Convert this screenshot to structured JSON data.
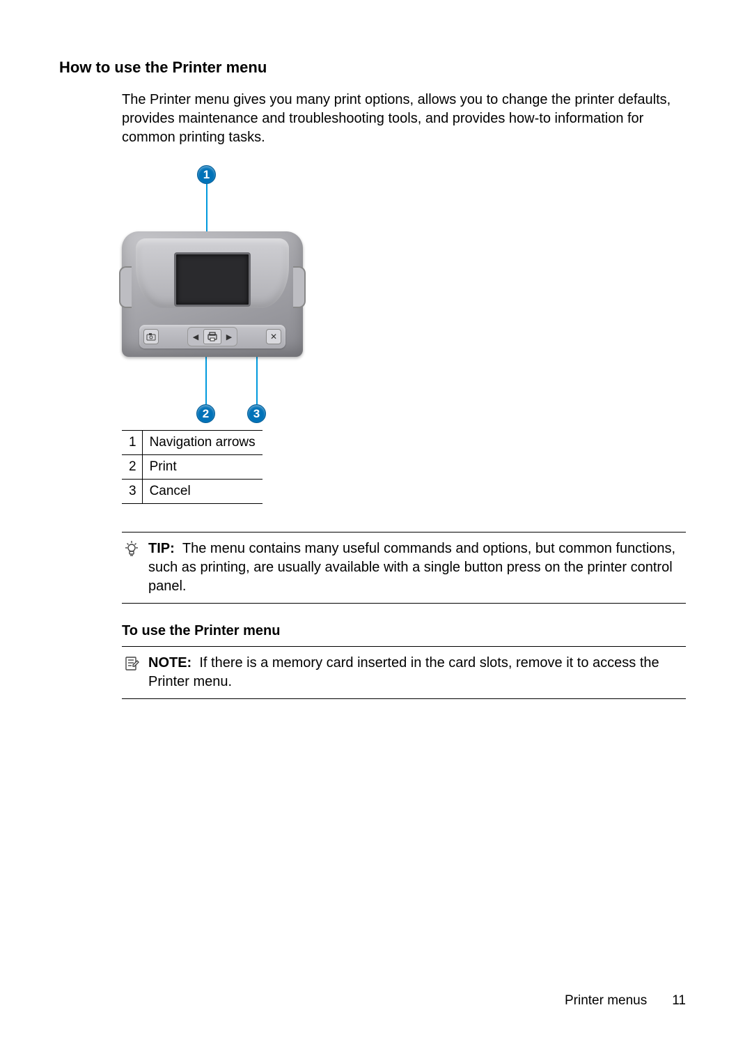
{
  "heading": "How to use the Printer menu",
  "intro": "The Printer menu gives you many print options, allows you to change the printer defaults, provides maintenance and troubleshooting tools, and provides how-to information for common printing tasks.",
  "callouts": {
    "c1": "1",
    "c2": "2",
    "c3": "3"
  },
  "legend": [
    {
      "num": "1",
      "label": "Navigation arrows"
    },
    {
      "num": "2",
      "label": "Print"
    },
    {
      "num": "3",
      "label": "Cancel"
    }
  ],
  "tip": {
    "label": "TIP:",
    "text": "The menu contains many useful commands and options, but common functions, such as printing, are usually available with a single button press on the printer control panel."
  },
  "subheading": "To use the Printer menu",
  "note": {
    "label": "NOTE:",
    "text": "If there is a memory card inserted in the card slots, remove it to access the Printer menu."
  },
  "footer": {
    "section": "Printer menus",
    "page": "11"
  }
}
